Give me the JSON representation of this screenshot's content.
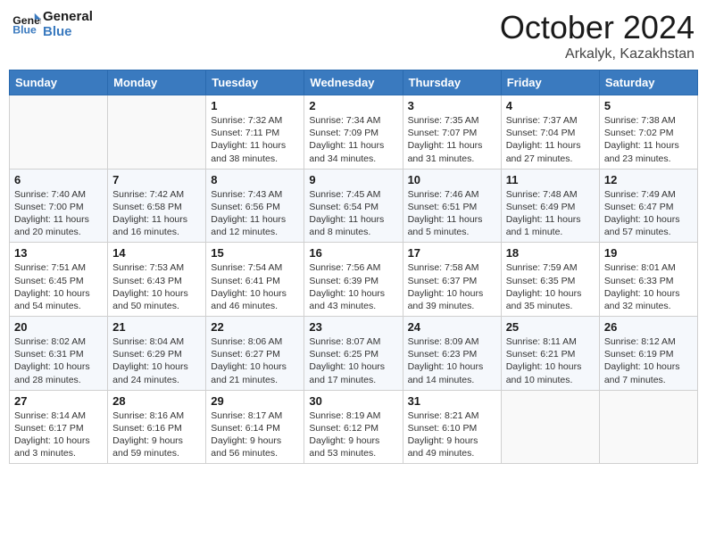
{
  "header": {
    "logo_line1": "General",
    "logo_line2": "Blue",
    "month_title": "October 2024",
    "location": "Arkalyk, Kazakhstan"
  },
  "weekdays": [
    "Sunday",
    "Monday",
    "Tuesday",
    "Wednesday",
    "Thursday",
    "Friday",
    "Saturday"
  ],
  "weeks": [
    [
      {
        "day": "",
        "sunrise": "",
        "sunset": "",
        "daylight": ""
      },
      {
        "day": "",
        "sunrise": "",
        "sunset": "",
        "daylight": ""
      },
      {
        "day": "1",
        "sunrise": "Sunrise: 7:32 AM",
        "sunset": "Sunset: 7:11 PM",
        "daylight": "Daylight: 11 hours and 38 minutes."
      },
      {
        "day": "2",
        "sunrise": "Sunrise: 7:34 AM",
        "sunset": "Sunset: 7:09 PM",
        "daylight": "Daylight: 11 hours and 34 minutes."
      },
      {
        "day": "3",
        "sunrise": "Sunrise: 7:35 AM",
        "sunset": "Sunset: 7:07 PM",
        "daylight": "Daylight: 11 hours and 31 minutes."
      },
      {
        "day": "4",
        "sunrise": "Sunrise: 7:37 AM",
        "sunset": "Sunset: 7:04 PM",
        "daylight": "Daylight: 11 hours and 27 minutes."
      },
      {
        "day": "5",
        "sunrise": "Sunrise: 7:38 AM",
        "sunset": "Sunset: 7:02 PM",
        "daylight": "Daylight: 11 hours and 23 minutes."
      }
    ],
    [
      {
        "day": "6",
        "sunrise": "Sunrise: 7:40 AM",
        "sunset": "Sunset: 7:00 PM",
        "daylight": "Daylight: 11 hours and 20 minutes."
      },
      {
        "day": "7",
        "sunrise": "Sunrise: 7:42 AM",
        "sunset": "Sunset: 6:58 PM",
        "daylight": "Daylight: 11 hours and 16 minutes."
      },
      {
        "day": "8",
        "sunrise": "Sunrise: 7:43 AM",
        "sunset": "Sunset: 6:56 PM",
        "daylight": "Daylight: 11 hours and 12 minutes."
      },
      {
        "day": "9",
        "sunrise": "Sunrise: 7:45 AM",
        "sunset": "Sunset: 6:54 PM",
        "daylight": "Daylight: 11 hours and 8 minutes."
      },
      {
        "day": "10",
        "sunrise": "Sunrise: 7:46 AM",
        "sunset": "Sunset: 6:51 PM",
        "daylight": "Daylight: 11 hours and 5 minutes."
      },
      {
        "day": "11",
        "sunrise": "Sunrise: 7:48 AM",
        "sunset": "Sunset: 6:49 PM",
        "daylight": "Daylight: 11 hours and 1 minute."
      },
      {
        "day": "12",
        "sunrise": "Sunrise: 7:49 AM",
        "sunset": "Sunset: 6:47 PM",
        "daylight": "Daylight: 10 hours and 57 minutes."
      }
    ],
    [
      {
        "day": "13",
        "sunrise": "Sunrise: 7:51 AM",
        "sunset": "Sunset: 6:45 PM",
        "daylight": "Daylight: 10 hours and 54 minutes."
      },
      {
        "day": "14",
        "sunrise": "Sunrise: 7:53 AM",
        "sunset": "Sunset: 6:43 PM",
        "daylight": "Daylight: 10 hours and 50 minutes."
      },
      {
        "day": "15",
        "sunrise": "Sunrise: 7:54 AM",
        "sunset": "Sunset: 6:41 PM",
        "daylight": "Daylight: 10 hours and 46 minutes."
      },
      {
        "day": "16",
        "sunrise": "Sunrise: 7:56 AM",
        "sunset": "Sunset: 6:39 PM",
        "daylight": "Daylight: 10 hours and 43 minutes."
      },
      {
        "day": "17",
        "sunrise": "Sunrise: 7:58 AM",
        "sunset": "Sunset: 6:37 PM",
        "daylight": "Daylight: 10 hours and 39 minutes."
      },
      {
        "day": "18",
        "sunrise": "Sunrise: 7:59 AM",
        "sunset": "Sunset: 6:35 PM",
        "daylight": "Daylight: 10 hours and 35 minutes."
      },
      {
        "day": "19",
        "sunrise": "Sunrise: 8:01 AM",
        "sunset": "Sunset: 6:33 PM",
        "daylight": "Daylight: 10 hours and 32 minutes."
      }
    ],
    [
      {
        "day": "20",
        "sunrise": "Sunrise: 8:02 AM",
        "sunset": "Sunset: 6:31 PM",
        "daylight": "Daylight: 10 hours and 28 minutes."
      },
      {
        "day": "21",
        "sunrise": "Sunrise: 8:04 AM",
        "sunset": "Sunset: 6:29 PM",
        "daylight": "Daylight: 10 hours and 24 minutes."
      },
      {
        "day": "22",
        "sunrise": "Sunrise: 8:06 AM",
        "sunset": "Sunset: 6:27 PM",
        "daylight": "Daylight: 10 hours and 21 minutes."
      },
      {
        "day": "23",
        "sunrise": "Sunrise: 8:07 AM",
        "sunset": "Sunset: 6:25 PM",
        "daylight": "Daylight: 10 hours and 17 minutes."
      },
      {
        "day": "24",
        "sunrise": "Sunrise: 8:09 AM",
        "sunset": "Sunset: 6:23 PM",
        "daylight": "Daylight: 10 hours and 14 minutes."
      },
      {
        "day": "25",
        "sunrise": "Sunrise: 8:11 AM",
        "sunset": "Sunset: 6:21 PM",
        "daylight": "Daylight: 10 hours and 10 minutes."
      },
      {
        "day": "26",
        "sunrise": "Sunrise: 8:12 AM",
        "sunset": "Sunset: 6:19 PM",
        "daylight": "Daylight: 10 hours and 7 minutes."
      }
    ],
    [
      {
        "day": "27",
        "sunrise": "Sunrise: 8:14 AM",
        "sunset": "Sunset: 6:17 PM",
        "daylight": "Daylight: 10 hours and 3 minutes."
      },
      {
        "day": "28",
        "sunrise": "Sunrise: 8:16 AM",
        "sunset": "Sunset: 6:16 PM",
        "daylight": "Daylight: 9 hours and 59 minutes."
      },
      {
        "day": "29",
        "sunrise": "Sunrise: 8:17 AM",
        "sunset": "Sunset: 6:14 PM",
        "daylight": "Daylight: 9 hours and 56 minutes."
      },
      {
        "day": "30",
        "sunrise": "Sunrise: 8:19 AM",
        "sunset": "Sunset: 6:12 PM",
        "daylight": "Daylight: 9 hours and 53 minutes."
      },
      {
        "day": "31",
        "sunrise": "Sunrise: 8:21 AM",
        "sunset": "Sunset: 6:10 PM",
        "daylight": "Daylight: 9 hours and 49 minutes."
      },
      {
        "day": "",
        "sunrise": "",
        "sunset": "",
        "daylight": ""
      },
      {
        "day": "",
        "sunrise": "",
        "sunset": "",
        "daylight": ""
      }
    ]
  ]
}
